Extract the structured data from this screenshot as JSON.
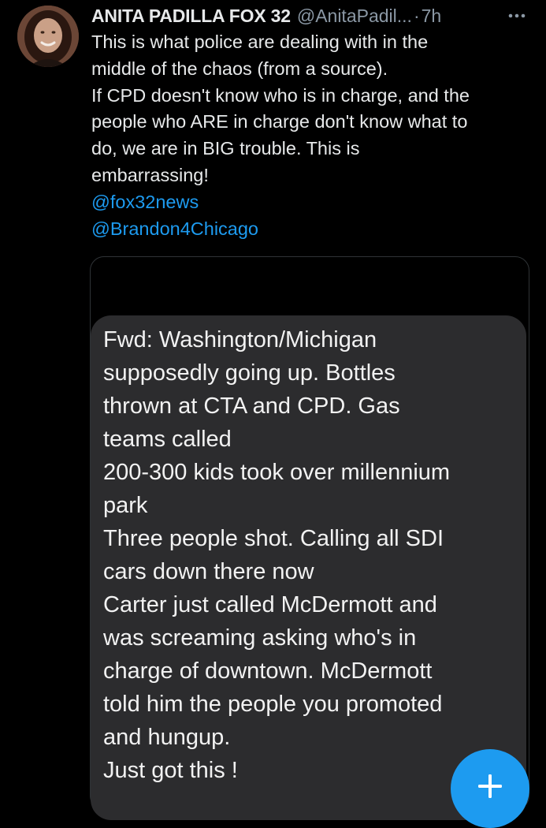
{
  "tweet": {
    "author_name": "ANITA PADILLA FOX 32",
    "author_handle": "@AnitaPadil...",
    "separator": "·",
    "timestamp": "7h",
    "body_lines": [
      "This is what police are dealing with in the",
      "middle of the chaos (from a source).",
      "If CPD doesn't know who is in charge, and the",
      "people who ARE in charge don't know what to",
      "do, we are in BIG trouble.  This is",
      "embarrassing!"
    ],
    "mentions": [
      "@fox32news",
      "@Brandon4Chicago"
    ],
    "icons": {
      "avatar": "profile-photo",
      "more": "more-horizontal-icon"
    }
  },
  "media": {
    "message_lines": [
      "Fwd: Washington/Michigan",
      "supposedly going up.  Bottles",
      "thrown at CTA and CPD.  Gas",
      "teams called",
      "200-300 kids took over millennium",
      "park",
      "Three people shot. Calling all SDI",
      "cars down there now",
      "Carter just called McDermott and",
      "was screaming asking who's in",
      "charge of downtown.  McDermott",
      "told him the people you promoted",
      "and hungup.",
      "Just got this !"
    ]
  },
  "compose": {
    "icon": "plus-icon"
  },
  "colors": {
    "background": "#000000",
    "text": "#e7e9ea",
    "secondary_text": "#8b98a5",
    "link": "#1d9bf0",
    "bubble": "#2c2c2e",
    "accent": "#1d9bf0"
  }
}
